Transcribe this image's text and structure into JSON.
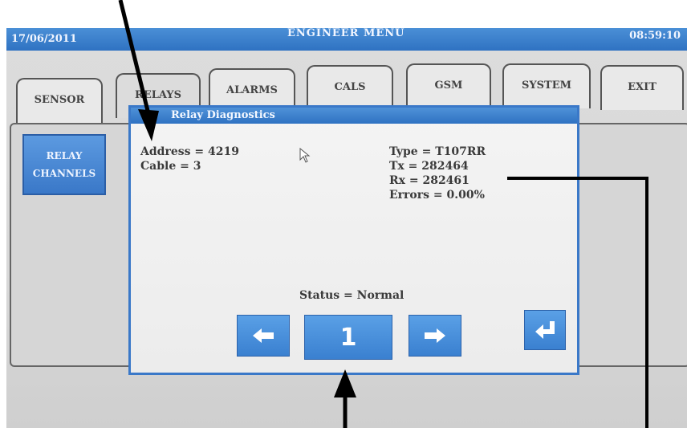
{
  "header": {
    "date": "17/06/2011",
    "title": "ENGINEER MENU",
    "time": "08:59:10"
  },
  "tabs": [
    {
      "label": "SENSOR"
    },
    {
      "label": "RELAYS"
    },
    {
      "label": "ALARMS"
    },
    {
      "label": "CALS"
    },
    {
      "label": "GSM"
    },
    {
      "label": "SYSTEM"
    },
    {
      "label": "EXIT"
    }
  ],
  "sidebar": {
    "button_line1": "RELAY",
    "button_line2": "CHANNELS"
  },
  "dialog": {
    "title": "Relay Diagnostics",
    "address": "Address = 4219",
    "cable": "Cable = 3",
    "type": "Type = T107RR",
    "tx": "Tx = 282464",
    "rx": "Rx = 282461",
    "errors": "Errors = 0.00%",
    "status": "Status = Normal",
    "page_number": "1"
  },
  "icons": {
    "prev": "left-arrow-icon",
    "next": "right-arrow-icon",
    "enter": "enter-icon",
    "pointer": "mouse-pointer-icon"
  },
  "colors": {
    "accent": "#3a78c8",
    "title_bar": "#2f72c2",
    "screen_bg": "#d8d8d8"
  }
}
